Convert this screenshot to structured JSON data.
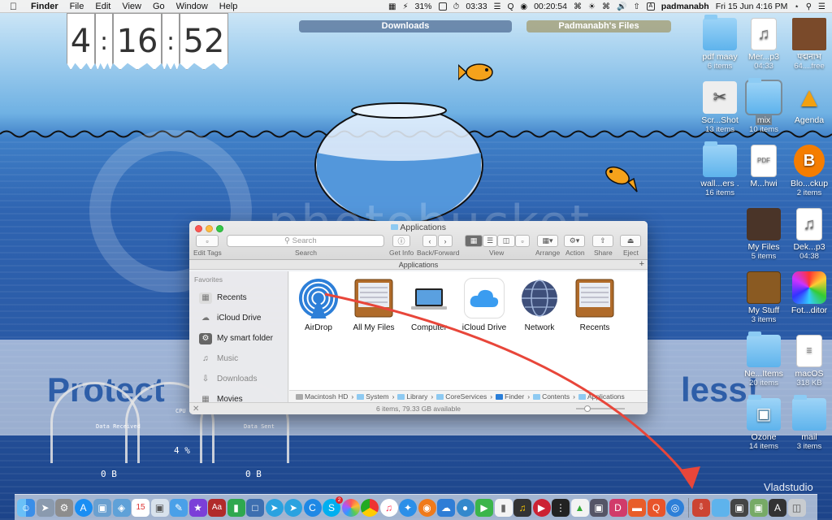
{
  "menubar": {
    "app_name": "Finder",
    "menus": [
      "File",
      "Edit",
      "View",
      "Go",
      "Window",
      "Help"
    ],
    "battery": "31%",
    "timer": "03:33",
    "stopwatch": "00:20:54",
    "user": "padmanabh",
    "datetime": "Fri 15 Jun  4:16 PM"
  },
  "clock": {
    "h": "4",
    "m": "16",
    "s": "52"
  },
  "pills": {
    "downloads": "Downloads",
    "padma_files": "Padmanabh's Files"
  },
  "wallpaper": {
    "watermark": "photobucket",
    "protect_left": "Protect",
    "protect_right": "less!",
    "credit": "Vladstudio"
  },
  "gauges": {
    "received_label": "Data Received",
    "sent_label": "Data Sent",
    "left_value": "0 B",
    "percent": "4 %",
    "right_value": "0 B",
    "cpu_label": "CPU"
  },
  "desktop_icons": [
    {
      "label": "pdf maay",
      "sub": "6 items",
      "kind": "folder"
    },
    {
      "label": "Mer...p3",
      "sub": "04:33",
      "kind": "audio"
    },
    {
      "label": "पद्मनाभ",
      "sub": "64....free",
      "kind": "photo"
    },
    {
      "label": "Scr...Shot",
      "sub": "13 items",
      "kind": "tool"
    },
    {
      "label": "mix",
      "sub": "10 items",
      "kind": "folder"
    },
    {
      "label": "Agenda",
      "sub": "",
      "kind": "app"
    },
    {
      "label": "wall...ers .",
      "sub": "16 items",
      "kind": "folder"
    },
    {
      "label": "M...hwi",
      "sub": "",
      "kind": "pdf"
    },
    {
      "label": "Blo...ckup",
      "sub": "2 items",
      "kind": "blogger"
    },
    {
      "label": "My Files",
      "sub": "5 items",
      "kind": "photo"
    },
    {
      "label": "Dek...p3",
      "sub": "04:38",
      "kind": "audio"
    },
    {
      "label": "My Stuff",
      "sub": "3 items",
      "kind": "cabinet"
    },
    {
      "label": "Fot...ditor",
      "sub": "",
      "kind": "color"
    },
    {
      "label": "Ne...Items",
      "sub": "20 items",
      "kind": "folder"
    },
    {
      "label": "macOS",
      "sub": "318 KB",
      "kind": "file"
    },
    {
      "label": "Ozone",
      "sub": "14 items",
      "kind": "folder-sofa"
    },
    {
      "label": "mail",
      "sub": "3 items",
      "kind": "folder"
    }
  ],
  "finder": {
    "title": "Applications",
    "toolbar": {
      "edit_tags": "Edit Tags",
      "search_placeholder": "Search",
      "search_label": "Search",
      "get_info": "Get Info",
      "back_forward": "Back/Forward",
      "view": "View",
      "arrange": "Arrange",
      "action": "Action",
      "share": "Share",
      "eject": "Eject"
    },
    "tab_title": "Applications",
    "sidebar_heading": "Favorites",
    "sidebar": [
      "Recents",
      "iCloud Drive",
      "My smart folder",
      "Music",
      "Downloads",
      "Movies"
    ],
    "items": [
      {
        "label": "AirDrop"
      },
      {
        "label": "All My Files"
      },
      {
        "label": "Computer"
      },
      {
        "label": "iCloud Drive"
      },
      {
        "label": "Network"
      },
      {
        "label": "Recents"
      }
    ],
    "path": [
      "Macintosh HD",
      "System",
      "Library",
      "CoreServices",
      "Finder",
      "Contents",
      "Applications"
    ],
    "status": "6 items, 79.33 GB available"
  },
  "dock": {
    "badge_count": "2",
    "icons": [
      "finder-icon",
      "launchpad-icon",
      "settings-icon",
      "appstore-icon",
      "preview-icon",
      "network-icon",
      "calendar-icon",
      "photos-icon",
      "pages-icon",
      "star-icon",
      "dictionary-icon",
      "numbers-icon",
      "screen-icon",
      "telegram-icon",
      "telegram2-icon",
      "c-icon",
      "skype-icon",
      "photos2-icon",
      "chrome-icon",
      "music-icon",
      "safari-icon",
      "firefox-icon",
      "onedrive-icon",
      "messages-icon",
      "facetime-icon",
      "book-icon",
      "guitar-icon",
      "video-icon",
      "dots-icon",
      "drive-icon",
      "photo-icon",
      "d-icon",
      "e-icon",
      "q-icon",
      "airdrop-icon",
      "downloads-icon",
      "folder-icon",
      "photo2-icon",
      "gallery-icon",
      "appstack-icon",
      "trash-icon"
    ]
  }
}
